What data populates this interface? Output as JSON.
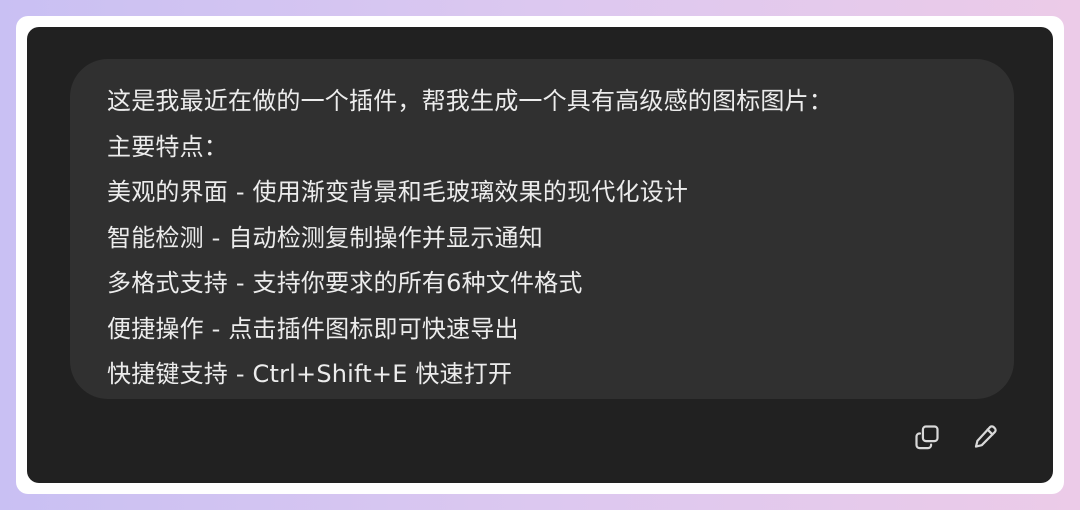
{
  "message": {
    "lines": [
      "这是我最近在做的一个插件，帮我生成一个具有高级感的图标图片：",
      "主要特点：",
      "美观的界面 - 使用渐变背景和毛玻璃效果的现代化设计",
      "智能检测 - 自动检测复制操作并显示通知",
      "多格式支持 - 支持你要求的所有6种文件格式",
      "便捷操作 - 点击插件图标即可快速导出",
      "快捷键支持 - Ctrl+Shift+E 快速打开"
    ]
  },
  "actions": {
    "copy_icon": "copy-icon",
    "edit_icon": "pencil-icon"
  },
  "colors": {
    "background_gradient_start": "#c9c0f3",
    "background_gradient_end": "#eccbe8",
    "panel": "#212121",
    "bubble": "#303030",
    "text": "#ececec"
  }
}
